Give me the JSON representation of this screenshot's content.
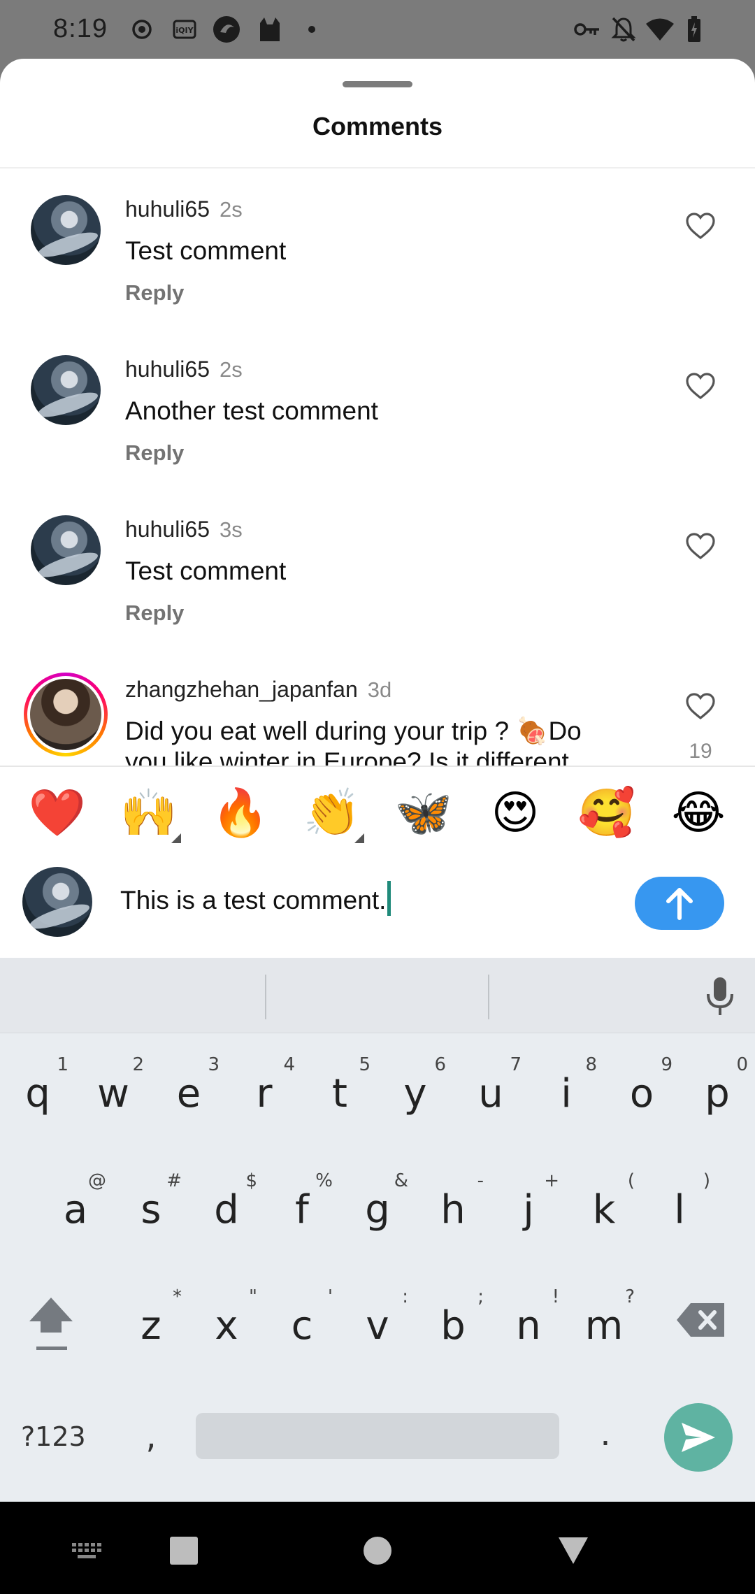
{
  "status_bar": {
    "time": "8:19"
  },
  "sheet": {
    "title": "Comments"
  },
  "comments": [
    {
      "user": "huhuli65",
      "time": "2s",
      "text": "Test comment",
      "reply": "Reply",
      "likes": ""
    },
    {
      "user": "huhuli65",
      "time": "2s",
      "text": "Another test comment",
      "reply": "Reply",
      "likes": ""
    },
    {
      "user": "huhuli65",
      "time": "3s",
      "text": "Test comment",
      "reply": "Reply",
      "likes": ""
    },
    {
      "user": "zhangzhehan_japanfan",
      "time": "3d",
      "text": "Did you eat well during your trip ? 🍖Do you like winter in Europe? Is it different",
      "reply": "",
      "likes": "19"
    }
  ],
  "emoji_bar": [
    "❤️",
    "🙌",
    "🔥",
    "👏",
    "🦋",
    "😍",
    "🥰",
    "😂"
  ],
  "input": {
    "value": "This is a test comment."
  },
  "keyboard": {
    "row1": [
      {
        "key": "q",
        "hint": "1"
      },
      {
        "key": "w",
        "hint": "2"
      },
      {
        "key": "e",
        "hint": "3"
      },
      {
        "key": "r",
        "hint": "4"
      },
      {
        "key": "t",
        "hint": "5"
      },
      {
        "key": "y",
        "hint": "6"
      },
      {
        "key": "u",
        "hint": "7"
      },
      {
        "key": "i",
        "hint": "8"
      },
      {
        "key": "o",
        "hint": "9"
      },
      {
        "key": "p",
        "hint": "0"
      }
    ],
    "row2": [
      {
        "key": "a",
        "hint": "@"
      },
      {
        "key": "s",
        "hint": "#"
      },
      {
        "key": "d",
        "hint": "$"
      },
      {
        "key": "f",
        "hint": "%"
      },
      {
        "key": "g",
        "hint": "&"
      },
      {
        "key": "h",
        "hint": "-"
      },
      {
        "key": "j",
        "hint": "+"
      },
      {
        "key": "k",
        "hint": "("
      },
      {
        "key": "l",
        "hint": ")"
      }
    ],
    "row3": [
      {
        "key": "z",
        "hint": "*"
      },
      {
        "key": "x",
        "hint": "\""
      },
      {
        "key": "c",
        "hint": "'"
      },
      {
        "key": "v",
        "hint": ":"
      },
      {
        "key": "b",
        "hint": ";"
      },
      {
        "key": "n",
        "hint": "!"
      },
      {
        "key": "m",
        "hint": "?"
      }
    ],
    "symbols_label": "?123",
    "comma": ",",
    "period": "."
  }
}
